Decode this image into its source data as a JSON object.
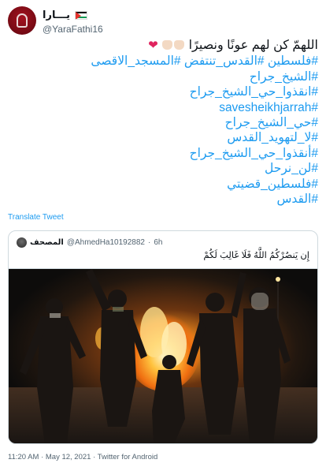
{
  "author": {
    "display_name": "يـــارا",
    "handle": "@YaraFathi16",
    "flag_icon": "palestine-flag-icon"
  },
  "tweet": {
    "first_line": "اللهمّ كن لهم عونًا ونصيرًا",
    "hashtag_lines": [
      "#فلسطين #القدس_تنتفض #المسجد_الاقصى",
      "#الشيخ_جراح",
      "#انقذوا_حي_الشيخ_جراح",
      "#savesheikhjarrah",
      "#حي_الشيخ_جراح",
      "#لا_لتهويد_القدس",
      "#أنقذوا_حي_الشيخ_جراح",
      "#لن_نرحل",
      "#فلسطين_قضيتي",
      "#القدس"
    ]
  },
  "translate_label": "Translate Tweet",
  "quoted": {
    "name": "المصحف",
    "handle": "@AhmedHa10192882",
    "separator": "·",
    "time": "6h",
    "text": "إِن يَنصُرْكُمُ اللَّهُ فَلَا غَالِبَ لَكُمْ"
  },
  "footer": {
    "meta": "11:20 AM · May 12, 2021 · Twitter for Android"
  },
  "colors": {
    "link": "#1d9bf0",
    "text": "#0f1419",
    "muted": "#536471",
    "border": "#cfd9de",
    "heart": "#e0245e"
  }
}
